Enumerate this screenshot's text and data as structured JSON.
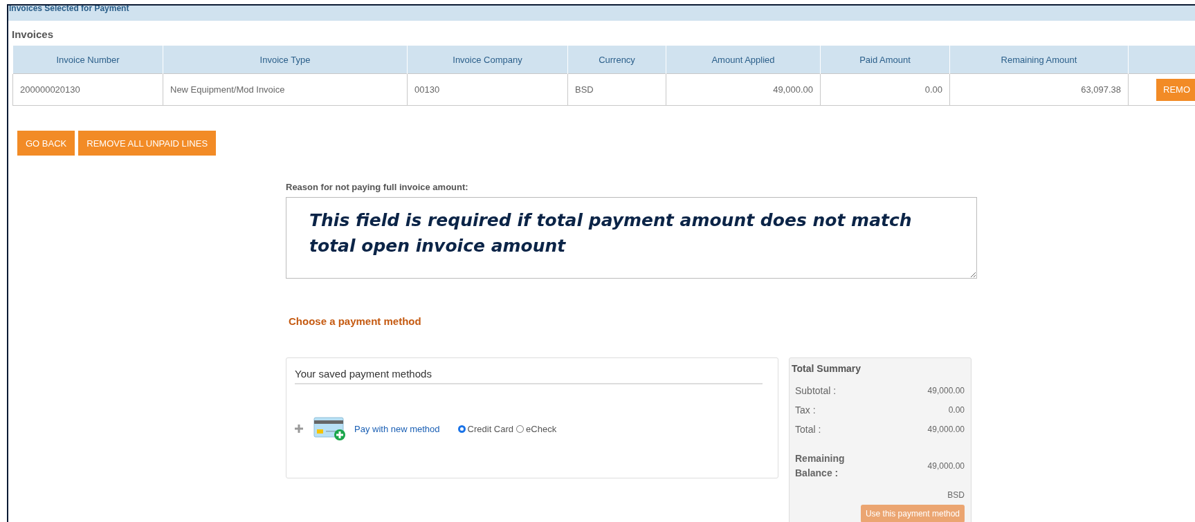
{
  "section_header": {
    "title": "Invoices Selected for Payment"
  },
  "invoices": {
    "heading": "Invoices",
    "columns": [
      {
        "label": "Invoice Number",
        "numeric": false
      },
      {
        "label": "Invoice Type",
        "numeric": false
      },
      {
        "label": "Invoice Company",
        "numeric": false
      },
      {
        "label": "Currency",
        "numeric": false
      },
      {
        "label": "Amount Applied",
        "numeric": true
      },
      {
        "label": "Paid Amount",
        "numeric": true
      },
      {
        "label": "Remaining Amount",
        "numeric": true
      }
    ],
    "rows": [
      {
        "cells": [
          "200000020130",
          "New Equipment/Mod Invoice",
          "00130",
          "BSD",
          "49,000.00",
          "0.00",
          "63,097.38"
        ],
        "action": "REMO"
      }
    ]
  },
  "buttons": [
    {
      "label": "GO BACK"
    },
    {
      "label": "REMOVE ALL UNPAID LINES"
    }
  ],
  "reason": {
    "label": "Reason for not paying full invoice amount:",
    "value": "This field is required if total payment amount does not match total open invoice amount"
  },
  "payment_heading": "Choose a payment method",
  "saved_methods": {
    "title": "Your saved payment methods",
    "new_method_link": "Pay with new method",
    "options": [
      {
        "label": "Credit Card",
        "selected": true
      },
      {
        "label": "eCheck",
        "selected": false
      }
    ]
  },
  "summary": {
    "title": "Total Summary",
    "lines": [
      {
        "label": "Subtotal :",
        "value": "49,000.00"
      },
      {
        "label": "Tax :",
        "value": "0.00"
      },
      {
        "label": "Total :",
        "value": "49,000.00"
      }
    ],
    "remaining": {
      "label": "Remaining Balance :",
      "value": "49,000.00"
    },
    "currency": "BSD",
    "button": {
      "label": "Use this payment method",
      "disabled": true
    }
  }
}
